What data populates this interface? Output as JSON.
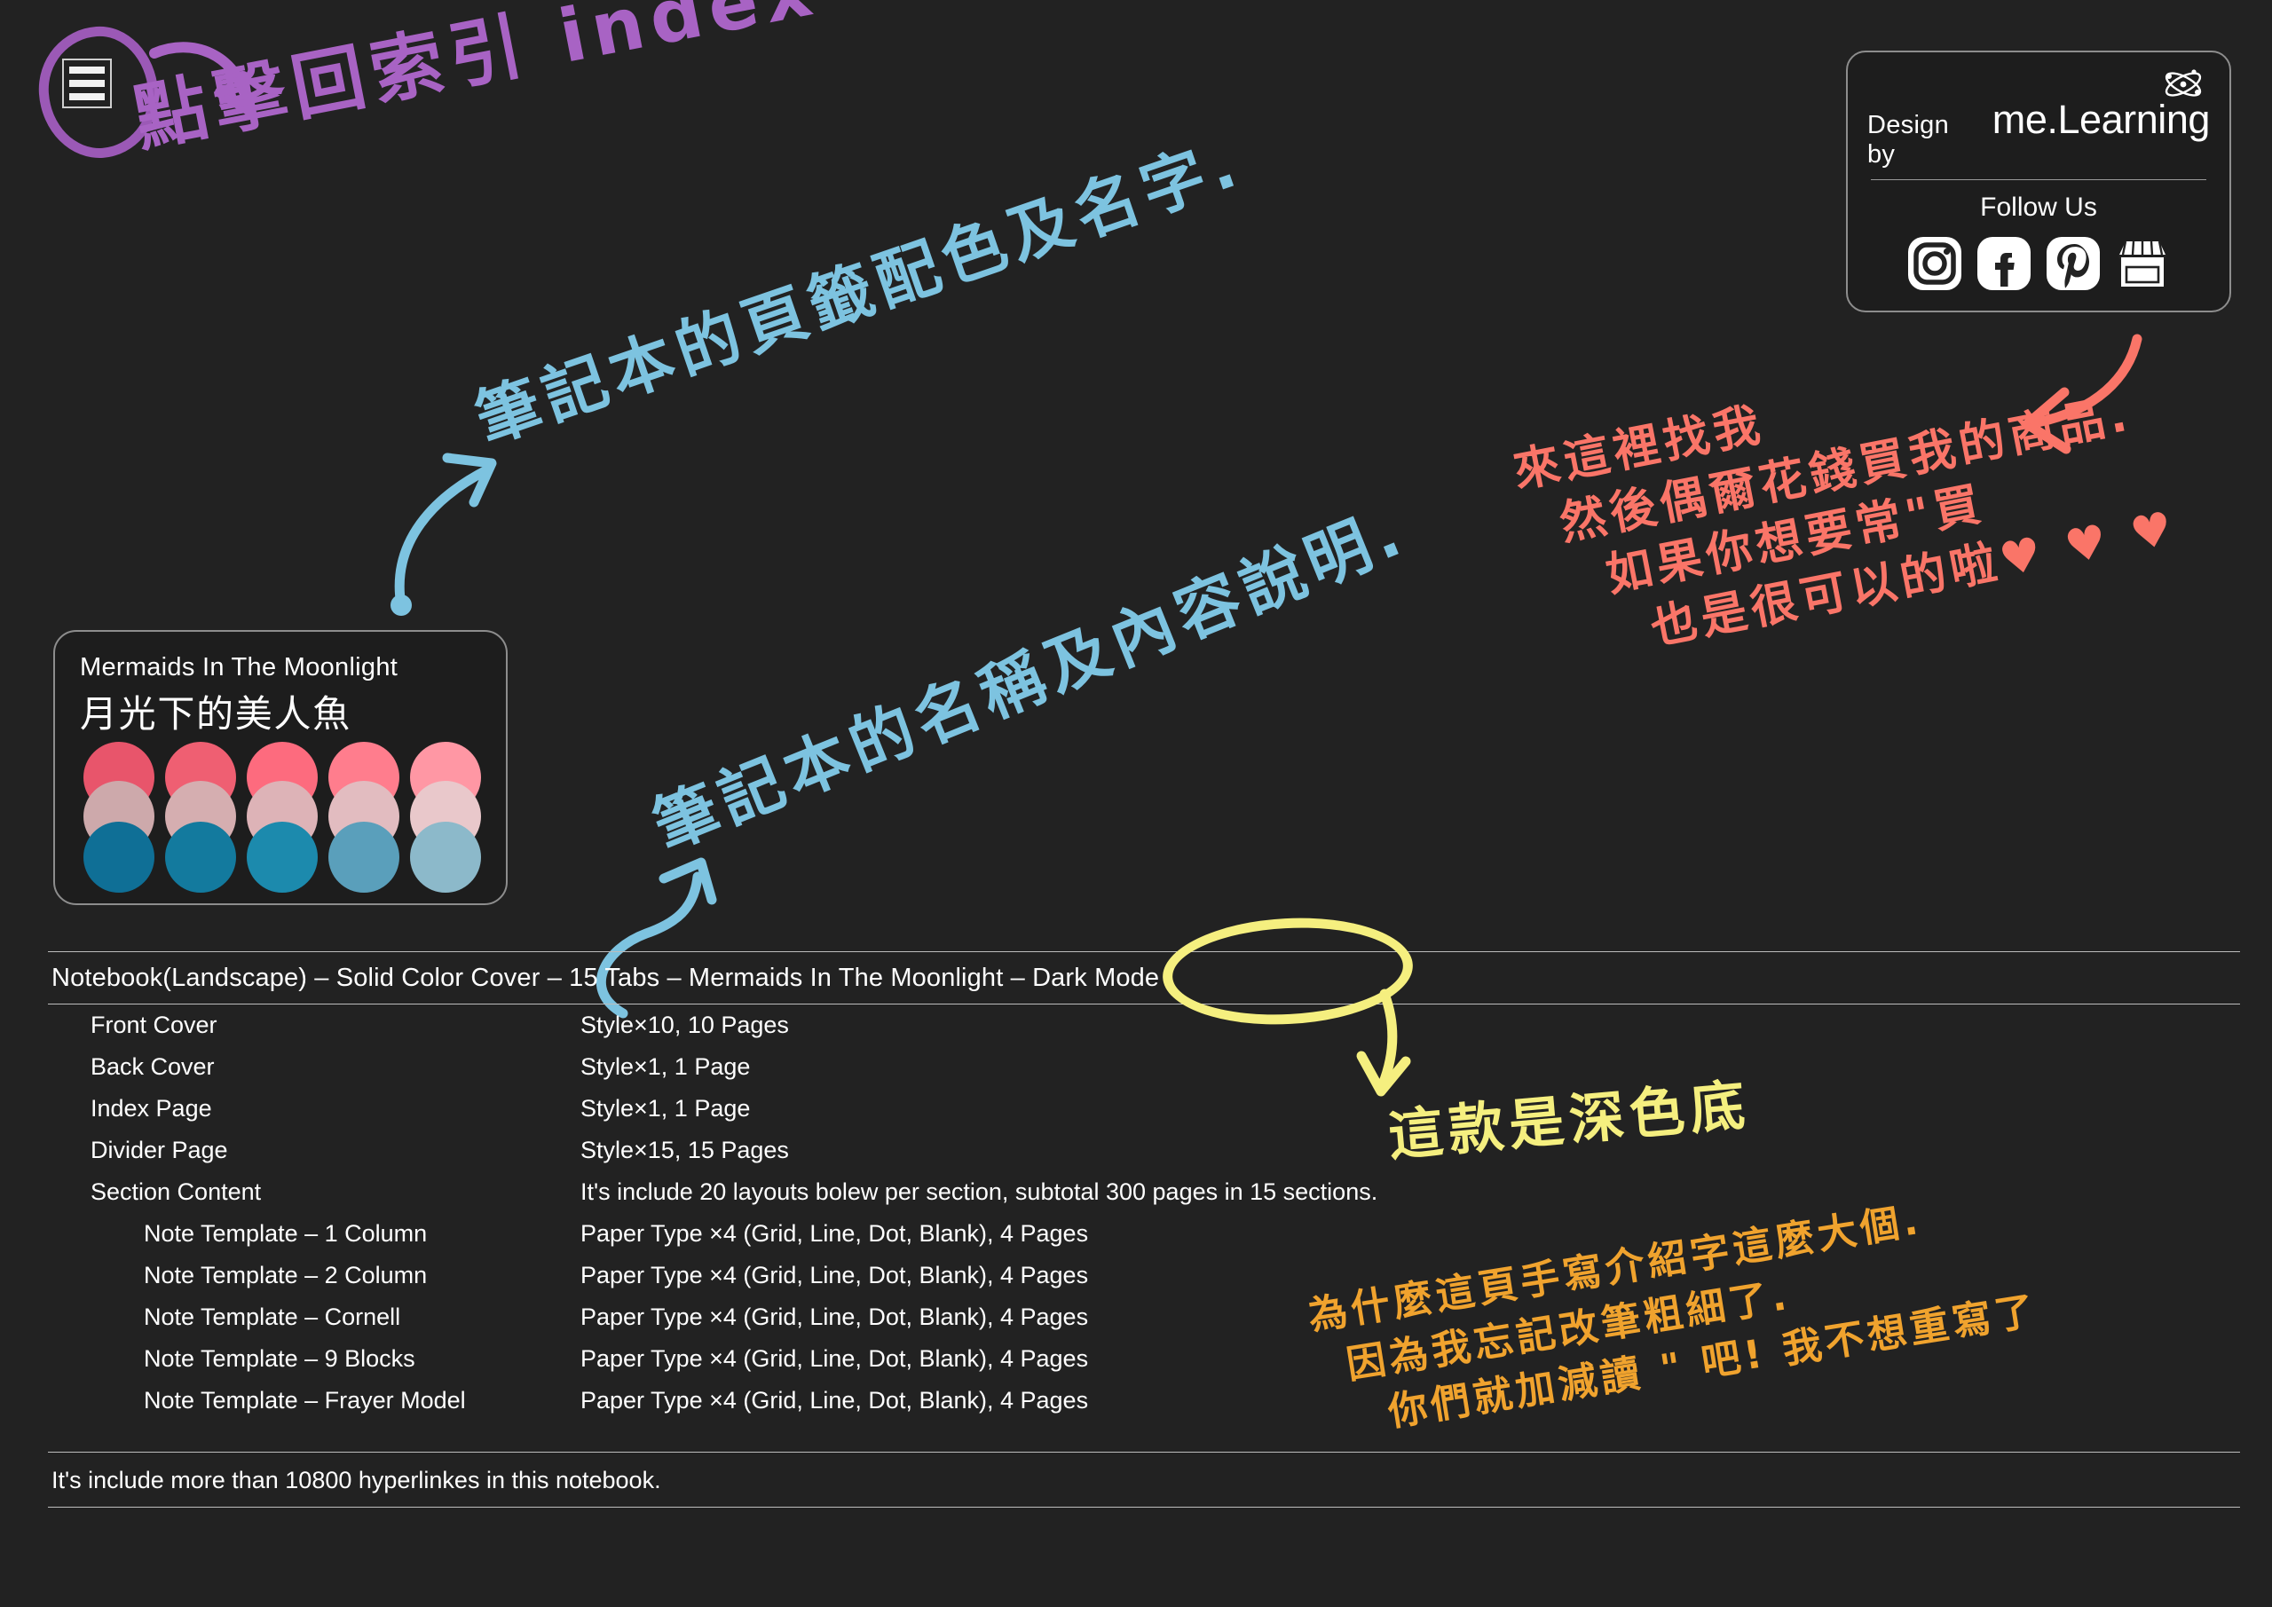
{
  "theme": {
    "background": "#222222",
    "text": "#ffffff",
    "rule": "#bdbdbd",
    "purple": "#a863c4",
    "blue": "#7dc3e0",
    "pink": "#fa7568",
    "yellow": "#f5ef7f",
    "orange": "#f0a32e"
  },
  "index_button": {
    "icon": "hamburger-menu-icon",
    "annotation": "點擊回索引 index"
  },
  "annotations": {
    "purple_note": "點擊回索引 index",
    "blue_note_1": "筆記本的頁籤配色及名字.",
    "blue_note_2": "筆記本的名稱及內容說明.",
    "pink_note_lines": [
      "來這裡找我",
      "然後偶爾花錢買我的商品.",
      "如果你想要常\"買",
      "也是很可以的啦♥ ♥ ♥"
    ],
    "yellow_note": "這款是深色底",
    "orange_note_lines": [
      "為什麼這頁手寫介紹字這麼大個.",
      "因為我忘記改筆粗細了.",
      "你們就加減讀 \" 吧!  我不想重寫了"
    ]
  },
  "palette_card": {
    "title_en": "Mermaids In The Moonlight",
    "title_zh": "月光下的美人魚",
    "columns": [
      {
        "top": "#e8556b",
        "middle": "#cda9ab",
        "bottom": "#0f6f96"
      },
      {
        "top": "#ef5f72",
        "middle": "#d5aeb0",
        "bottom": "#137a9e"
      },
      {
        "top": "#fd6b7e",
        "middle": "#ddb3b7",
        "bottom": "#1c8aad"
      },
      {
        "top": "#ff7d8d",
        "middle": "#e2bcc0",
        "bottom": "#5a9fbb"
      },
      {
        "top": "#ff97a4",
        "middle": "#e9c8cb",
        "bottom": "#8cb9ca"
      }
    ]
  },
  "brand_card": {
    "design_by": "Design by",
    "brand_name": "me.Learning",
    "follow_us": "Follow Us",
    "socials": [
      {
        "name": "instagram-icon"
      },
      {
        "name": "facebook-icon"
      },
      {
        "name": "pinterest-icon"
      },
      {
        "name": "storefront-icon"
      }
    ],
    "atom_icon": "atom-icon"
  },
  "spec": {
    "title": "Notebook(Landscape) – Solid Color Cover – 15 Tabs – Mermaids In The Moonlight – Dark Mode",
    "rows": [
      {
        "indent": false,
        "name": "Front Cover",
        "value": "Style×10, 10 Pages"
      },
      {
        "indent": false,
        "name": "Back Cover",
        "value": "Style×1, 1 Page"
      },
      {
        "indent": false,
        "name": "Index Page",
        "value": "Style×1, 1 Page"
      },
      {
        "indent": false,
        "name": "Divider Page",
        "value": "Style×15, 15 Pages"
      },
      {
        "indent": false,
        "name": "Section Content",
        "value": "It's include 20 layouts bolew per section, subtotal 300 pages in 15 sections."
      },
      {
        "indent": true,
        "name": "Note Template – 1 Column",
        "value": "Paper Type ×4 (Grid, Line, Dot, Blank), 4 Pages"
      },
      {
        "indent": true,
        "name": "Note Template – 2 Column",
        "value": "Paper Type ×4 (Grid, Line, Dot, Blank), 4 Pages"
      },
      {
        "indent": true,
        "name": "Note Template – Cornell",
        "value": "Paper Type ×4 (Grid, Line, Dot, Blank), 4 Pages"
      },
      {
        "indent": true,
        "name": "Note Template – 9 Blocks",
        "value": "Paper Type ×4 (Grid, Line, Dot, Blank), 4 Pages"
      },
      {
        "indent": true,
        "name": "Note Template – Frayer Model",
        "value": "Paper Type ×4 (Grid, Line, Dot, Blank), 4 Pages"
      }
    ],
    "footer": "It's include more than 10800 hyperlinkes in this notebook."
  }
}
